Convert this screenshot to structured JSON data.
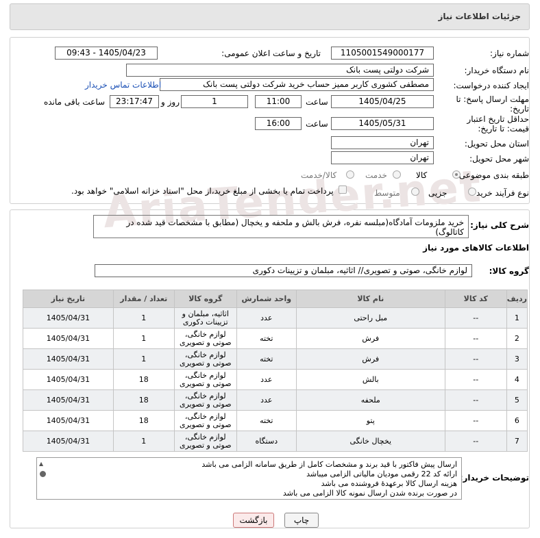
{
  "header": {
    "title": "جزئیات اطلاعات نیاز"
  },
  "watermark": "AriaTender.net",
  "form": {
    "need_no_label": "شماره نیاز:",
    "need_no": "1105001549000177",
    "announce_label": "تاریخ و ساعت اعلان عمومی:",
    "announce_value": "1405/04/23 - 09:43",
    "buyer_label": "نام دستگاه خریدار:",
    "buyer": "شرکت دولتی پست بانک",
    "creator_label": "ایجاد کننده درخواست:",
    "creator": "مصطفی کشوری کاربر ممیز حساب خرید شرکت دولتی پست بانک",
    "contact_link": "اطلاعات تماس خریدار",
    "deadline_label": "مهلت ارسال پاسخ: تا تاریخ:",
    "deadline_date": "1405/04/25",
    "time_label": "ساعت",
    "deadline_time": "11:00",
    "days": "1",
    "days_label": "روز و",
    "remaining": "23:17:47",
    "remaining_label": "ساعت باقی مانده",
    "validity_label": "حداقل تاریخ اعتبار قیمت: تا تاریخ:",
    "validity_date": "1405/05/31",
    "validity_time": "16:00",
    "province_label": "استان محل تحویل:",
    "province": "تهران",
    "city_label": "شهر محل تحویل:",
    "city": "تهران",
    "category_label": "طبقه بندی موضوعی:",
    "cat_options": [
      "کالا",
      "خدمت",
      "کالا/خدمت"
    ],
    "process_label": "نوع فرآیند خرید :",
    "proc_options": [
      "جزیی",
      "متوسط"
    ],
    "payment_note": "پرداخت تمام یا بخشی از مبلغ خرید،از محل \"اسناد خزانه اسلامی\" خواهد بود."
  },
  "desc_label": "شرح کلی نیاز:",
  "desc": "خرید ملزومات آمادگاه(مبلسه نفره، فرش بالش و ملحفه و یخچال (مطابق با مشخصات قید شده در کاتالوگ)",
  "items_title": "اطلاعات کالاهای مورد نیاز",
  "group_label": "گروه کالا:",
  "group": "لوازم خانگی، صوتی و تصویری// اثاثیه، مبلمان و تزیینات دکوری",
  "table": {
    "headers": [
      "ردیف",
      "کد کالا",
      "نام کالا",
      "واحد شمارش",
      "گروه کالا",
      "تعداد / مقدار",
      "تاریخ نیاز"
    ],
    "rows": [
      [
        "1",
        "--",
        "مبل راحتی",
        "عدد",
        "اثاثیه، مبلمان و تزیینات دکوری",
        "1",
        "1405/04/31"
      ],
      [
        "2",
        "--",
        "فرش",
        "تخته",
        "لوازم خانگی، صوتی و تصویری",
        "1",
        "1405/04/31"
      ],
      [
        "3",
        "--",
        "فرش",
        "تخته",
        "لوازم خانگی، صوتی و تصویری",
        "1",
        "1405/04/31"
      ],
      [
        "4",
        "--",
        "بالش",
        "عدد",
        "لوازم خانگی، صوتی و تصویری",
        "18",
        "1405/04/31"
      ],
      [
        "5",
        "--",
        "ملحفه",
        "عدد",
        "لوازم خانگی، صوتی و تصویری",
        "18",
        "1405/04/31"
      ],
      [
        "6",
        "--",
        "پتو",
        "تخته",
        "لوازم خانگی، صوتی و تصویری",
        "18",
        "1405/04/31"
      ],
      [
        "7",
        "--",
        "یخچال خانگی",
        "دستگاه",
        "لوازم خانگی، صوتی و تصویری",
        "1",
        "1405/04/31"
      ]
    ]
  },
  "notes_label": "توضیحات خریدار:",
  "notes": [
    "ارسال پیش فاکتور با قید برند و مشخصات کامل از طریق سامانه الزامی می باشد",
    "ارائه کد 22 رقمی مودیان مالیاتی الزامی میباشد",
    "هزینه ارسال کالا برعهدهٔ فروشنده می باشد",
    "در صورت برنده شدن ارسال نمونه کالا الزامی می باشد"
  ],
  "buttons": {
    "print": "چاپ",
    "back": "بازگشت"
  }
}
